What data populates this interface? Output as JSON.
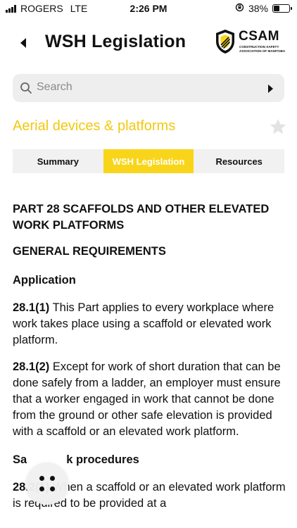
{
  "status_bar": {
    "carrier": "ROGERS",
    "network": "LTE",
    "time": "2:26 PM",
    "battery": "38%",
    "battery_level": 0.38
  },
  "header": {
    "title": "WSH Legislation",
    "logo_name": "CSAM",
    "logo_subtitle": "CONSTRUCTION SAFETY ASSOCIATION OF MANITOBA"
  },
  "search": {
    "placeholder": "Search"
  },
  "topic": {
    "title": "Aerial devices & platforms",
    "color": "#f2c80f"
  },
  "tabs": [
    {
      "label": "Summary",
      "active": false
    },
    {
      "label": "WSH Legislation",
      "active": true
    },
    {
      "label": "Resources",
      "active": false
    }
  ],
  "content": {
    "part_title": "PART 28 SCAFFOLDS AND OTHER ELEVATED WORK PLATFORMS",
    "section_title": "GENERAL REQUIREMENTS",
    "subsection_1": "Application",
    "p1_num": "28.1(1)",
    "p1_text": " This Part applies to every workplace where work takes place using a scaffold or elevated work platform.",
    "p2_num": "28.1(2)",
    "p2_text": " Except for work of short duration that can be done safely from a ladder, an employer must ensure that a worker engaged in work that cannot be done from the ground or other safe elevation is provided with a scaffold or an elevated work platform.",
    "subsection_2_start": "Sa",
    "subsection_2_end": "k procedures",
    "p3_num": "28.2(1)",
    "p3_text": " When a scaffold or an elevated work platform is required to be provided at a"
  },
  "colors": {
    "accent": "#f8d51a",
    "tab_bg": "#f1f1f1",
    "search_bg": "#eeeeee"
  }
}
